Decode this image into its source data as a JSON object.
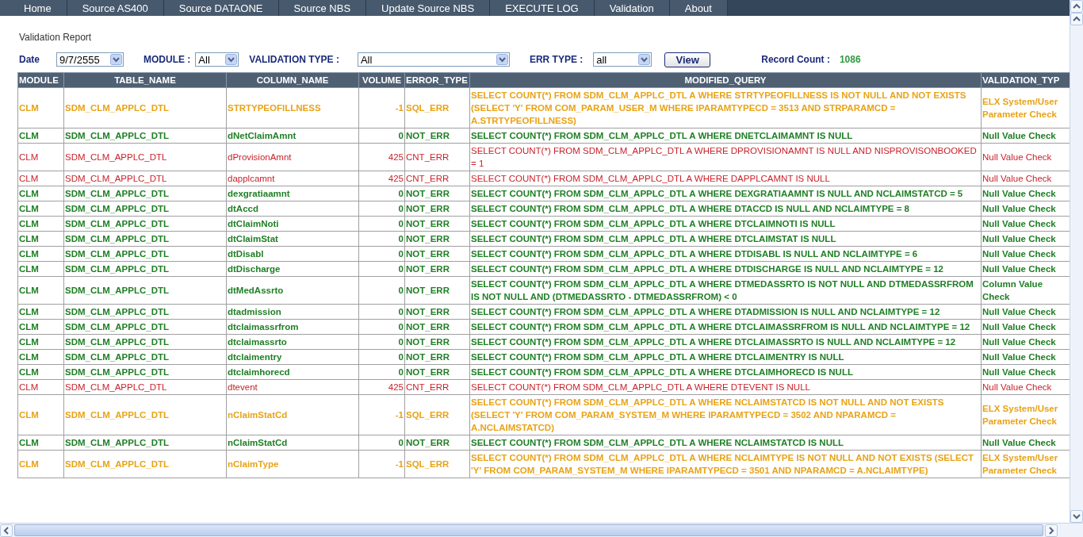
{
  "nav": [
    {
      "label": "Home",
      "selected": false
    },
    {
      "label": "Source AS400",
      "selected": false
    },
    {
      "label": "Source DATAONE",
      "selected": false
    },
    {
      "label": "Source NBS",
      "selected": false
    },
    {
      "label": "Update Source NBS",
      "selected": false
    },
    {
      "label": "EXECUTE LOG",
      "selected": false
    },
    {
      "label": "Validation",
      "selected": false
    },
    {
      "label": "About",
      "selected": false
    }
  ],
  "page_title": "Validation Report",
  "filters": [
    {
      "label": "Date",
      "value": "9/7/2555",
      "kind": "date"
    },
    {
      "label": "MODULE :",
      "value": "All",
      "kind": "module"
    },
    {
      "label": "VALIDATION TYPE :",
      "value": "All",
      "kind": "validation"
    },
    {
      "label": "ERR TYPE :",
      "value": "all",
      "kind": "err"
    }
  ],
  "view_button": "View",
  "record_count": {
    "label": "Record Count :",
    "value": "1086"
  },
  "table": {
    "columns": [
      "MODULE",
      "TABLE_NAME",
      "COLUMN_NAME",
      "VOLUME",
      "ERROR_TYPE",
      "MODIFIED_QUERY",
      "VALIDATION_TYP"
    ],
    "rows": [
      {
        "kind": "sql_err",
        "cells": [
          "CLM",
          "SDM_CLM_APPLC_DTL",
          "STRTYPEOFILLNESS",
          "-1",
          "SQL_ERR",
          "SELECT COUNT(*) FROM SDM_CLM_APPLC_DTL A WHERE STRTYPEOFILLNESS IS NOT NULL AND NOT EXISTS (SELECT 'Y' FROM COM_PARAM_USER_M WHERE IPARAMTYPECD = 3513 AND STRPARAMCD = A.STRTYPEOFILLNESS)",
          "ELX System/User Parameter Check"
        ]
      },
      {
        "kind": "not_err",
        "cells": [
          "CLM",
          "SDM_CLM_APPLC_DTL",
          "dNetClaimAmnt",
          "0",
          "NOT_ERR",
          "SELECT COUNT(*) FROM SDM_CLM_APPLC_DTL A WHERE DNETCLAIMAMNT IS NULL",
          "Null Value Check"
        ]
      },
      {
        "kind": "cnt_err",
        "cells": [
          "CLM",
          "SDM_CLM_APPLC_DTL",
          "dProvisionAmnt",
          "425",
          "CNT_ERR",
          "SELECT COUNT(*) FROM SDM_CLM_APPLC_DTL A WHERE DPROVISIONAMNT IS NULL AND NISPROVISONBOOKED = 1",
          "Null Value Check"
        ]
      },
      {
        "kind": "cnt_err",
        "cells": [
          "CLM",
          "SDM_CLM_APPLC_DTL",
          "dapplcamnt",
          "425",
          "CNT_ERR",
          "SELECT COUNT(*) FROM SDM_CLM_APPLC_DTL A WHERE DAPPLCAMNT IS NULL",
          "Null Value Check"
        ]
      },
      {
        "kind": "not_err",
        "cells": [
          "CLM",
          "SDM_CLM_APPLC_DTL",
          "dexgratiaamnt",
          "0",
          "NOT_ERR",
          "SELECT COUNT(*) FROM SDM_CLM_APPLC_DTL A WHERE DEXGRATIAAMNT IS NULL AND NCLAIMSTATCD = 5",
          "Null Value Check"
        ]
      },
      {
        "kind": "not_err",
        "cells": [
          "CLM",
          "SDM_CLM_APPLC_DTL",
          "dtAccd",
          "0",
          "NOT_ERR",
          "SELECT COUNT(*) FROM SDM_CLM_APPLC_DTL A WHERE DTACCD IS NULL AND NCLAIMTYPE = 8",
          "Null Value Check"
        ]
      },
      {
        "kind": "not_err",
        "cells": [
          "CLM",
          "SDM_CLM_APPLC_DTL",
          "dtClaimNoti",
          "0",
          "NOT_ERR",
          "SELECT COUNT(*) FROM SDM_CLM_APPLC_DTL A WHERE DTCLAIMNOTI IS NULL",
          "Null Value Check"
        ]
      },
      {
        "kind": "not_err",
        "cells": [
          "CLM",
          "SDM_CLM_APPLC_DTL",
          "dtClaimStat",
          "0",
          "NOT_ERR",
          "SELECT COUNT(*) FROM SDM_CLM_APPLC_DTL A WHERE DTCLAIMSTAT IS NULL",
          "Null Value Check"
        ]
      },
      {
        "kind": "not_err",
        "cells": [
          "CLM",
          "SDM_CLM_APPLC_DTL",
          "dtDisabl",
          "0",
          "NOT_ERR",
          "SELECT COUNT(*) FROM SDM_CLM_APPLC_DTL A WHERE DTDISABL IS NULL AND NCLAIMTYPE = 6",
          "Null Value Check"
        ]
      },
      {
        "kind": "not_err",
        "cells": [
          "CLM",
          "SDM_CLM_APPLC_DTL",
          "dtDischarge",
          "0",
          "NOT_ERR",
          "SELECT COUNT(*) FROM SDM_CLM_APPLC_DTL A WHERE DTDISCHARGE IS NULL AND NCLAIMTYPE = 12",
          "Null Value Check"
        ]
      },
      {
        "kind": "not_err",
        "cells": [
          "CLM",
          "SDM_CLM_APPLC_DTL",
          "dtMedAssrto",
          "0",
          "NOT_ERR",
          "SELECT COUNT(*) FROM SDM_CLM_APPLC_DTL A WHERE DTMEDASSRTO IS NOT NULL AND DTMEDASSRFROM IS NOT NULL AND (DTMEDASSRTO - DTMEDASSRFROM) < 0",
          "Column Value Check"
        ]
      },
      {
        "kind": "not_err",
        "cells": [
          "CLM",
          "SDM_CLM_APPLC_DTL",
          "dtadmission",
          "0",
          "NOT_ERR",
          "SELECT COUNT(*) FROM SDM_CLM_APPLC_DTL A WHERE DTADMISSION IS NULL AND NCLAIMTYPE = 12",
          "Null Value Check"
        ]
      },
      {
        "kind": "not_err",
        "cells": [
          "CLM",
          "SDM_CLM_APPLC_DTL",
          "dtclaimassrfrom",
          "0",
          "NOT_ERR",
          "SELECT COUNT(*) FROM SDM_CLM_APPLC_DTL A WHERE DTCLAIMASSRFROM IS NULL AND NCLAIMTYPE = 12",
          "Null Value Check"
        ]
      },
      {
        "kind": "not_err",
        "cells": [
          "CLM",
          "SDM_CLM_APPLC_DTL",
          "dtclaimassrto",
          "0",
          "NOT_ERR",
          "SELECT COUNT(*) FROM SDM_CLM_APPLC_DTL A WHERE DTCLAIMASSRTO IS NULL AND NCLAIMTYPE = 12",
          "Null Value Check"
        ]
      },
      {
        "kind": "not_err",
        "cells": [
          "CLM",
          "SDM_CLM_APPLC_DTL",
          "dtclaimentry",
          "0",
          "NOT_ERR",
          "SELECT COUNT(*) FROM SDM_CLM_APPLC_DTL A WHERE DTCLAIMENTRY IS NULL",
          "Null Value Check"
        ]
      },
      {
        "kind": "not_err",
        "cells": [
          "CLM",
          "SDM_CLM_APPLC_DTL",
          "dtclaimhorecd",
          "0",
          "NOT_ERR",
          "SELECT COUNT(*) FROM SDM_CLM_APPLC_DTL A WHERE DTCLAIMHORECD IS NULL",
          "Null Value Check"
        ]
      },
      {
        "kind": "cnt_err",
        "cells": [
          "CLM",
          "SDM_CLM_APPLC_DTL",
          "dtevent",
          "425",
          "CNT_ERR",
          "SELECT COUNT(*) FROM SDM_CLM_APPLC_DTL A WHERE DTEVENT IS NULL",
          "Null Value Check"
        ]
      },
      {
        "kind": "sql_err",
        "cells": [
          "CLM",
          "SDM_CLM_APPLC_DTL",
          "nClaimStatCd",
          "-1",
          "SQL_ERR",
          "SELECT COUNT(*) FROM SDM_CLM_APPLC_DTL A WHERE NCLAIMSTATCD IS NOT NULL AND NOT EXISTS (SELECT 'Y' FROM COM_PARAM_SYSTEM_M WHERE IPARAMTYPECD = 3502 AND NPARAMCD = A.NCLAIMSTATCD)",
          "ELX System/User Parameter Check"
        ]
      },
      {
        "kind": "not_err",
        "cells": [
          "CLM",
          "SDM_CLM_APPLC_DTL",
          "nClaimStatCd",
          "0",
          "NOT_ERR",
          "SELECT COUNT(*) FROM SDM_CLM_APPLC_DTL A WHERE NCLAIMSTATCD IS NULL",
          "Null Value Check"
        ]
      },
      {
        "kind": "sql_err",
        "cells": [
          "CLM",
          "SDM_CLM_APPLC_DTL",
          "nClaimType",
          "-1",
          "SQL_ERR",
          "SELECT COUNT(*) FROM SDM_CLM_APPLC_DTL A WHERE NCLAIMTYPE IS NOT NULL AND NOT EXISTS (SELECT 'Y' FROM COM_PARAM_SYSTEM_M WHERE IPARAMTYPECD = 3501 AND NPARAMCD = A.NCLAIMTYPE)",
          "ELX System/User Parameter Check"
        ]
      }
    ]
  }
}
